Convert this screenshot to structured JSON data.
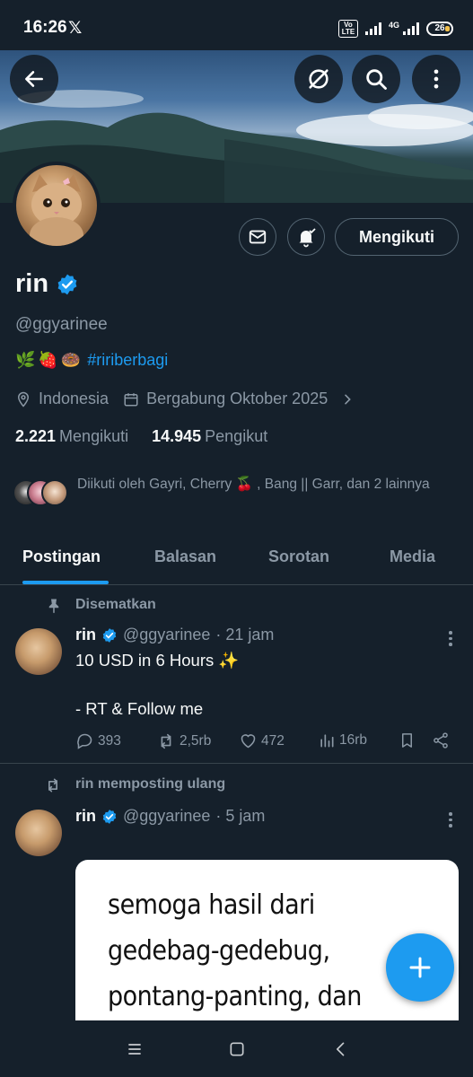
{
  "status_bar": {
    "time": "16:26",
    "x_logo": "𝕏",
    "volte": "Vo LTE",
    "network": "4G",
    "battery": "26"
  },
  "header": {
    "back_icon": "arrow-left-icon",
    "grok_icon": "grok-icon",
    "search_icon": "search-icon",
    "more_icon": "more-vertical-icon"
  },
  "profile": {
    "name": "rin",
    "handle": "@ggyarinee",
    "bio_emojis": [
      "🌿",
      "🍓",
      "🍩"
    ],
    "bio_hashtag": "#ririberbagi",
    "location": "Indonesia",
    "joined": "Bergabung Oktober 2025",
    "following_count": "2.221",
    "following_label": "Mengikuti",
    "followers_count": "14.945",
    "followers_label": "Pengikut",
    "followed_by": "Diikuti oleh Gayri, Cherry 🍒 , Bang || Garr, dan 2 lainnya",
    "follow_button": "Mengikuti"
  },
  "tabs": [
    {
      "label": "Postingan",
      "active": true
    },
    {
      "label": "Balasan",
      "active": false
    },
    {
      "label": "Sorotan",
      "active": false
    },
    {
      "label": "Media",
      "active": false
    }
  ],
  "posts": [
    {
      "context": "Disematkan",
      "context_icon": "pin-icon",
      "name": "rin",
      "handle": "@ggyarinee",
      "time": "· 21 jam",
      "text_line1": "10 USD in 6 Hours ✨",
      "text_line2": "- RT & Follow me",
      "replies": "393",
      "reposts": "2,5rb",
      "likes": "472",
      "views": "16rb"
    },
    {
      "context": "rin memposting ulang",
      "context_icon": "repost-icon",
      "name": "rin",
      "handle": "@ggyarinee",
      "time": "· 5 jam",
      "media_lines": [
        "semoga hasil dari",
        "gedebag-gedebug,",
        "pontang-panting, dan"
      ]
    }
  ],
  "colors": {
    "background": "#15202b",
    "accent": "#1d9bf0",
    "secondary_text": "#8b98a5",
    "border": "#38444d"
  }
}
